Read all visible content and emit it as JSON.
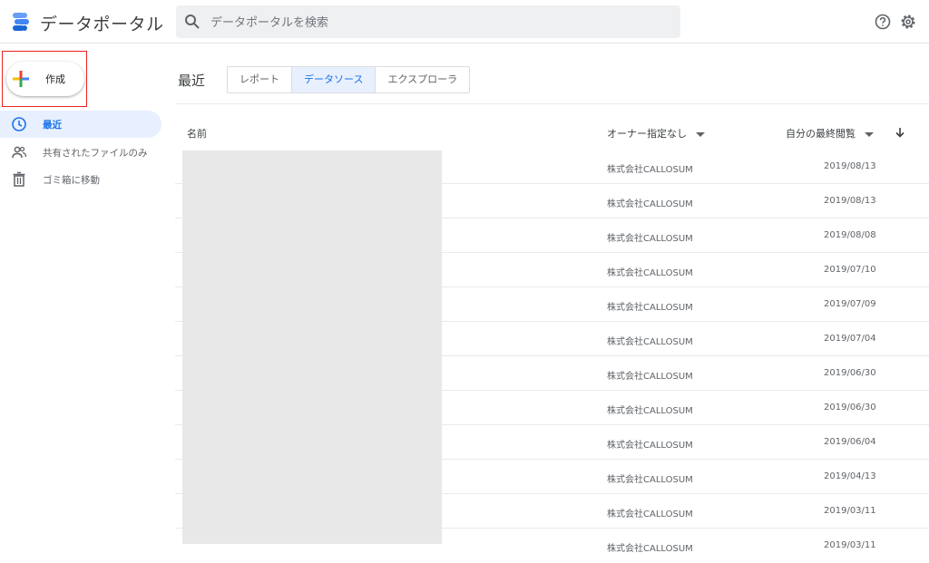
{
  "app": {
    "title": "データポータル"
  },
  "search": {
    "placeholder": "データポータルを検索"
  },
  "header_icons": [
    "help-icon",
    "settings-icon"
  ],
  "sidebar": {
    "create_label": "作成",
    "items": [
      {
        "label": "最近",
        "icon": "clock-icon",
        "active": true
      },
      {
        "label": "共有されたファイルのみ",
        "icon": "people-icon",
        "active": false
      },
      {
        "label": "ゴミ箱に移動",
        "icon": "trash-icon",
        "active": false
      }
    ]
  },
  "main": {
    "title": "最近",
    "tabs": [
      {
        "label": "レポート",
        "active": false
      },
      {
        "label": "データソース",
        "active": true
      },
      {
        "label": "エクスプローラ",
        "active": false
      }
    ],
    "columns": {
      "name": "名前",
      "owner": "オーナー指定なし",
      "last_viewed": "自分の最終閲覧"
    },
    "rows": [
      {
        "owner": "株式会社CALLOSUM",
        "date": "2019/08/13"
      },
      {
        "owner": "株式会社CALLOSUM",
        "date": "2019/08/13"
      },
      {
        "owner": "株式会社CALLOSUM",
        "date": "2019/08/08"
      },
      {
        "owner": "株式会社CALLOSUM",
        "date": "2019/07/10"
      },
      {
        "owner": "株式会社CALLOSUM",
        "date": "2019/07/09"
      },
      {
        "owner": "株式会社CALLOSUM",
        "date": "2019/07/04"
      },
      {
        "owner": "株式会社CALLOSUM",
        "date": "2019/06/30"
      },
      {
        "owner": "株式会社CALLOSUM",
        "date": "2019/06/30"
      },
      {
        "owner": "株式会社CALLOSUM",
        "date": "2019/06/04"
      },
      {
        "owner": "株式会社CALLOSUM",
        "date": "2019/04/13"
      },
      {
        "owner": "株式会社CALLOSUM",
        "date": "2019/03/11"
      },
      {
        "owner": "株式会社CALLOSUM",
        "date": "2019/03/11"
      }
    ]
  },
  "colors": {
    "accent": "#1a73e8",
    "active_bg": "#e8f0fe",
    "highlight": "#e8231f"
  }
}
